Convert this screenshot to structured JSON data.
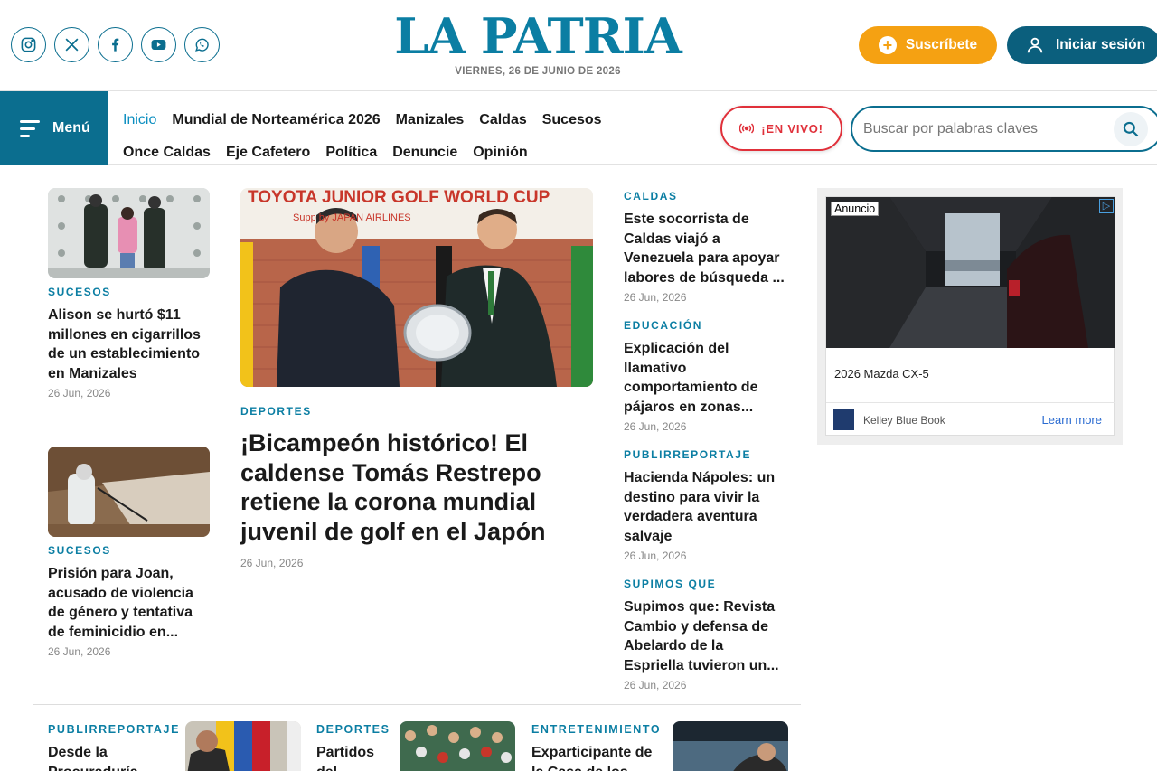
{
  "header": {
    "logo": "LA PATRIA",
    "date": "VIERNES, 26 DE JUNIO DE 2026",
    "subscribe_label": "Suscríbete",
    "login_label": "Iniciar sesión",
    "social_icons": [
      "instagram-icon",
      "x-icon",
      "facebook-icon",
      "youtube-icon",
      "whatsapp-icon"
    ]
  },
  "nav": {
    "menu_label": "Menú",
    "row1": [
      "Inicio",
      "Mundial de Norteamérica 2026",
      "Manizales",
      "Caldas",
      "Sucesos"
    ],
    "row2": [
      "Once Caldas",
      "Eje Cafetero",
      "Política",
      "Denuncie",
      "Opinión"
    ],
    "live_label": "¡EN VIVO!",
    "search_placeholder": "Buscar por palabras claves"
  },
  "left_articles": [
    {
      "category": "SUCESOS",
      "title": "Alison se hurtó $11 millones en cigarrillos de un establecimiento en Manizales",
      "date": "26 Jun, 2026"
    },
    {
      "category": "SUCESOS",
      "title": "Prisión para Joan, acusado de violencia de género y tentativa de feminicidio en...",
      "date": "26 Jun, 2026"
    }
  ],
  "main_article": {
    "image_banner": "TOYOTA JUNIOR GOLF WORLD CUP",
    "image_sub": "Supp    by JAPAN AIRLINES",
    "category": "DEPORTES",
    "title": "¡Bicampeón histórico! El caldense Tomás Restrepo retiene la corona mundial juvenil de golf en el Japón",
    "date": "26 Jun, 2026"
  },
  "right_articles": [
    {
      "category": "CALDAS",
      "title": "Este socorrista de Caldas viajó a Venezuela para apoyar labores de búsqueda ...",
      "date": "26 Jun, 2026"
    },
    {
      "category": "EDUCACIÓN",
      "title": "Explicación del llamativo comportamiento de pájaros en zonas...",
      "date": "26 Jun, 2026"
    },
    {
      "category": "PUBLIRREPORTAJE",
      "title": "Hacienda Nápoles: un destino para vivir la verdadera aventura salvaje",
      "date": "26 Jun, 2026"
    },
    {
      "category": "SUPIMOS QUE",
      "title": "Supimos que: Revista Cambio y defensa de Abelardo de la Espriella tuvieron un...",
      "date": "26 Jun, 2026"
    }
  ],
  "ad": {
    "label": "Anuncio",
    "title": "2026 Mazda CX-5",
    "advertiser": "Kelley Blue Book",
    "cta": "Learn more"
  },
  "bottom_articles": [
    {
      "category": "PUBLIRREPORTAJE",
      "title": "Desde la Procuraduría"
    },
    {
      "category": "DEPORTES",
      "title": "Partidos del"
    },
    {
      "category": "ENTRETENIMIENTO",
      "title": "Exparticipante de la Casa de los"
    }
  ],
  "colors": {
    "brand": "#0b6e8f",
    "accent": "#f5a112",
    "live": "#e0303a"
  }
}
